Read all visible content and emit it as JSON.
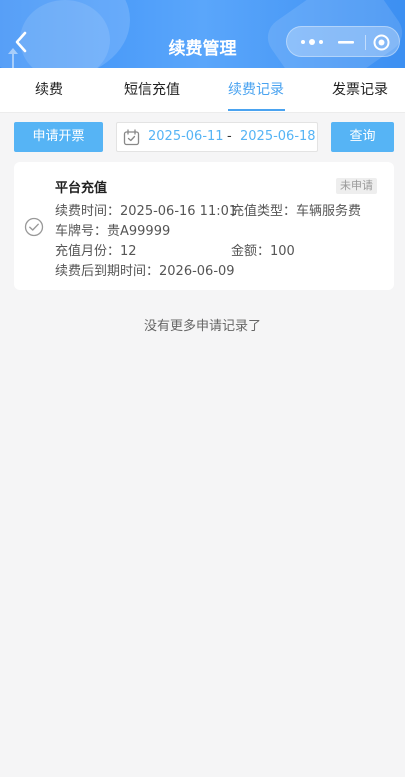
{
  "header": {
    "title": "续费管理",
    "gradient_colors": [
      "#3a8ff6",
      "#5aa6fb",
      "#3c8ff2"
    ]
  },
  "tabs": [
    {
      "label": "续费",
      "active": false
    },
    {
      "label": "短信充值",
      "active": false
    },
    {
      "label": "续费记录",
      "active": true
    },
    {
      "label": "发票记录",
      "active": false
    }
  ],
  "filter": {
    "apply_label": "申请开票",
    "date_start": "2025-06-11",
    "date_separator": "-",
    "date_end": "2025-06-18",
    "query_label": "查询"
  },
  "record": {
    "title": "平台充值",
    "status": "未申请",
    "renew_time": "续费时间：2025-06-16 11:01",
    "recharge_type": "充值类型：车辆服务费",
    "plate": "车牌号：贵A99999",
    "months": "充值月份：12",
    "amount": "金额：100",
    "expire_time": "续费后到期时间：2026-06-09"
  },
  "footer": {
    "no_more": "没有更多申请记录了"
  },
  "colors": {
    "accent": "#56b4f5",
    "tab_active": "#4aa3f0",
    "background": "#f5f5f6"
  }
}
